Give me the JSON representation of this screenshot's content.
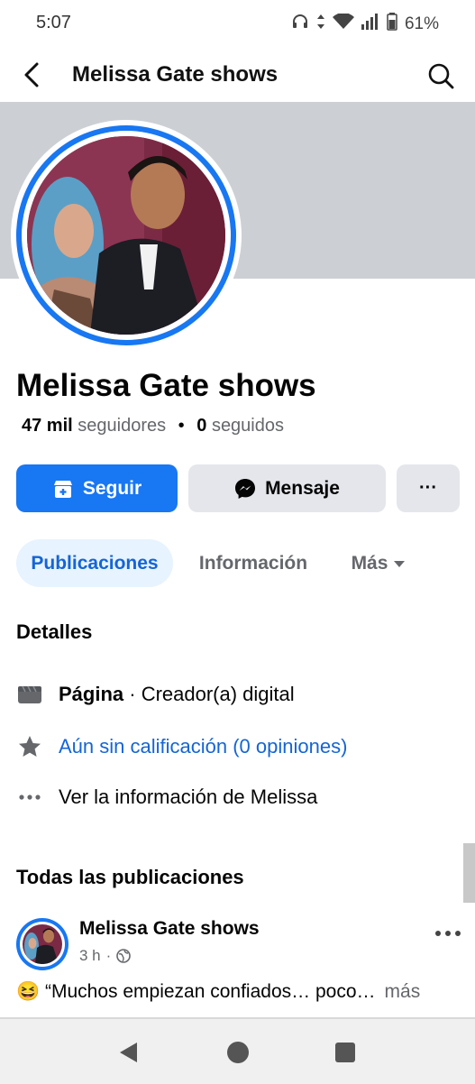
{
  "status_bar": {
    "time": "5:07",
    "battery": "61%"
  },
  "topbar": {
    "title": "Melissa Gate shows"
  },
  "profile": {
    "name": "Melissa Gate shows",
    "followers_count": "47 mil",
    "followers_label": "seguidores",
    "following_count": "0",
    "following_label": "seguidos"
  },
  "actions": {
    "follow": "Seguir",
    "message": "Mensaje",
    "more": "···"
  },
  "tabs": [
    {
      "label": "Publicaciones"
    },
    {
      "label": "Información"
    },
    {
      "label": "Más"
    }
  ],
  "details": {
    "title": "Detalles",
    "category_bold": "Página",
    "category_rest": " · Creador(a) digital",
    "rating": "Aún sin calificación (0 opiniones)",
    "see_info": "Ver la información de Melissa"
  },
  "posts": {
    "title": "Todas las publicaciones",
    "first": {
      "author": "Melissa Gate shows",
      "time": "3 h",
      "emoji": "😆",
      "text": " “Muchos empiezan confiados… poco…",
      "more": "más"
    }
  },
  "icons": [
    "back-arrow-icon",
    "search-icon",
    "store-icon",
    "messenger-icon",
    "ellipsis-icon",
    "caret-down-icon",
    "page-flag-icon",
    "star-icon",
    "globe-icon",
    "nav-back-icon",
    "nav-home-icon",
    "nav-recents-icon"
  ],
  "colors": {
    "accent": "#1877f2",
    "link": "#1465d6",
    "cover": "#ccd0d5",
    "button_gray": "#e4e6eb",
    "tab_active_bg": "#e7f3ff"
  }
}
